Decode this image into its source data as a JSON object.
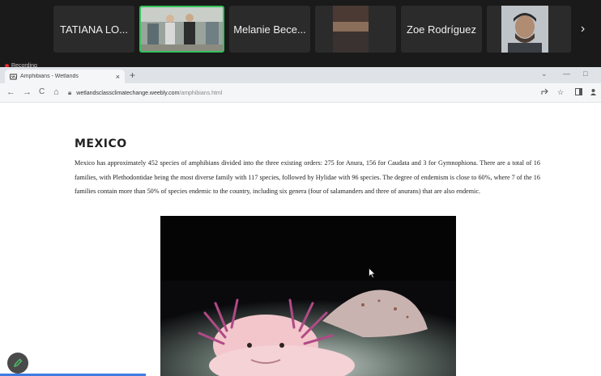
{
  "zoom": {
    "participants": [
      {
        "name": "TATIANA LO...",
        "type": "name"
      },
      {
        "name": "",
        "type": "video-room"
      },
      {
        "name": "Melanie Bece...",
        "type": "name"
      },
      {
        "name": "",
        "type": "video-sunset"
      },
      {
        "name": "Zoe Rodríguez",
        "type": "name"
      },
      {
        "name": "",
        "type": "video-person"
      }
    ],
    "next_icon": "chevron-right-icon",
    "recording_label": "Recording",
    "active_speaker_color": "#35c15c"
  },
  "browser": {
    "tab_title": "Amphibians - Wetlands",
    "tab_close": "×",
    "new_tab": "+",
    "url_host": "wetlandsclassclimatechange.weebly.com",
    "url_path": "/amphibians.html",
    "nav": {
      "back": "←",
      "forward": "→",
      "reload": "C",
      "home": "⌂"
    },
    "window_controls": {
      "dropdown": "⌄",
      "minimize": "—",
      "restore": "□"
    }
  },
  "content": {
    "heading": "MEXICO",
    "paragraph": "Mexico has approximately 452 species of amphibians divided into the three existing orders: 275 for Anura, 156 for Caudata and 3 for Gymnophiona. There are a total of 16 families, with Plethodontidae being the most diverse family with 117 species, followed by Hylidae with 96 species. The degree of endemism is close to 60%, where 7 of the 16 families contain more than 50% of species endemic to the country, including six genera (four of salamanders and three of anurans) that are also endemic.",
    "image_subject": "axolotl-image"
  }
}
